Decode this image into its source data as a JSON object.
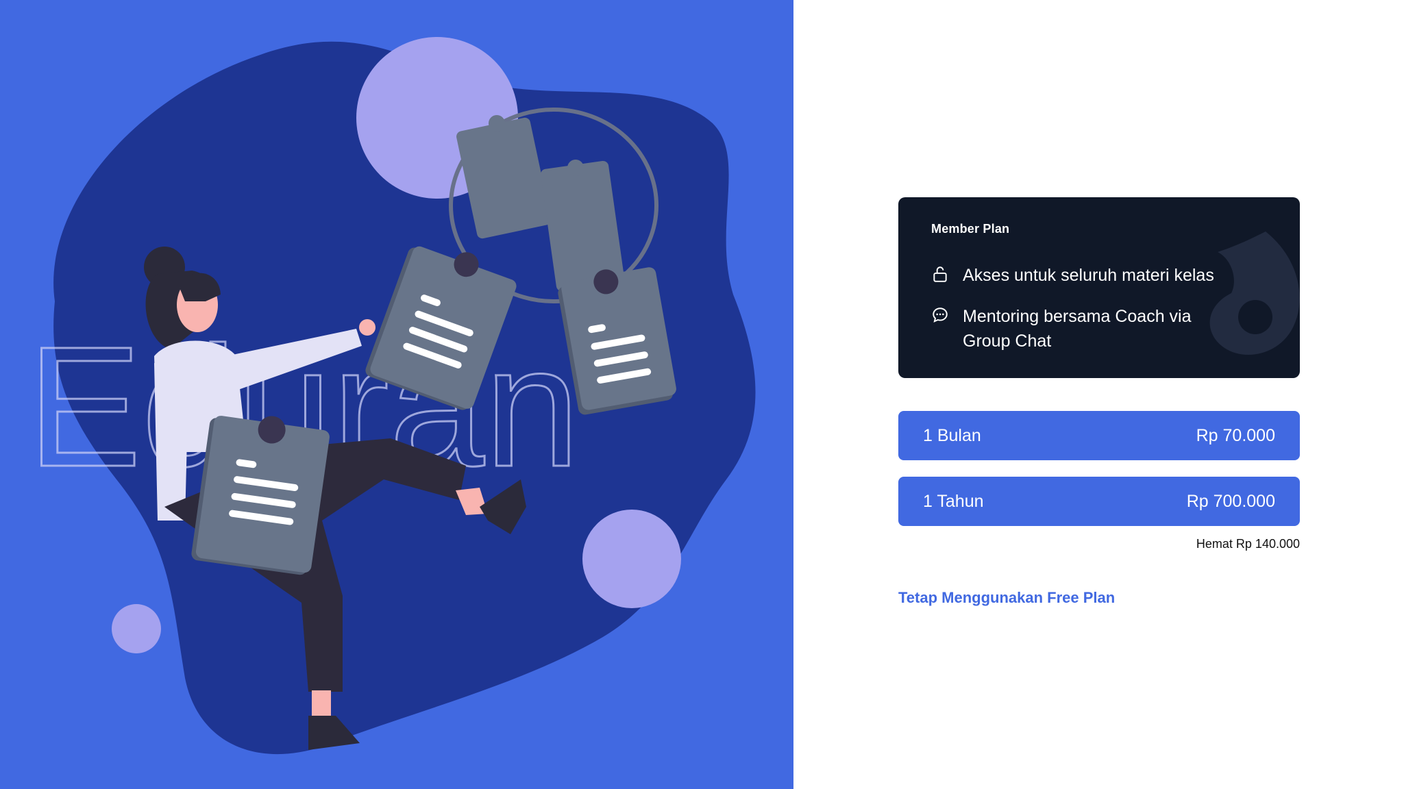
{
  "hero": {
    "bg_color": "#4169e1",
    "blob_color": "#1e3593",
    "accent_circle_color": "#a5a2ef",
    "watermark_text": "Eduran",
    "illustration": "woman-with-document-clipboards"
  },
  "plan": {
    "title": "Member Plan",
    "card_color": "#101828",
    "features": [
      {
        "icon": "unlock-icon",
        "text": "Akses untuk seluruh materi kelas"
      },
      {
        "icon": "chat-bubble-icon",
        "text": "Mentoring bersama Coach via Group Chat"
      }
    ]
  },
  "pricing": {
    "options": [
      {
        "period": "1 Bulan",
        "price": "Rp 70.000"
      },
      {
        "period": "1 Tahun",
        "price": "Rp 700.000"
      }
    ],
    "savings_note": "Hemat Rp 140.000",
    "button_color": "#4169e1"
  },
  "free_plan_link": "Tetap Menggunakan Free Plan"
}
